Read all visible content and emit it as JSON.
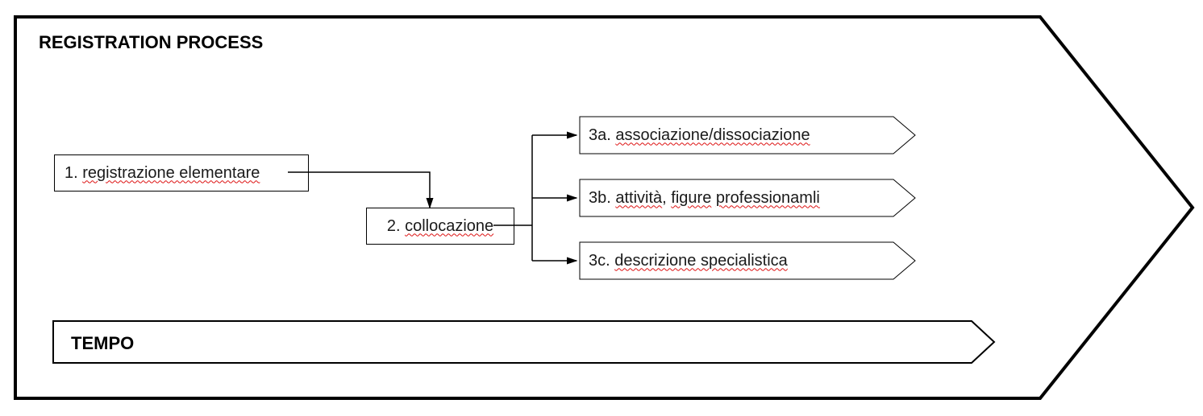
{
  "title": "REGISTRATION PROCESS",
  "step1": {
    "prefix": "1. ",
    "text": "registrazione elementare"
  },
  "step2": {
    "prefix": "2. ",
    "text": "collocazione"
  },
  "step3a": {
    "prefix": "3a. ",
    "text1": "associazione/dissociazione"
  },
  "step3b": {
    "prefix": "3b. ",
    "w1": "attività",
    "sep": ", ",
    "w2": "figure",
    "w3": " ",
    "w4": "professionamli"
  },
  "step3c": {
    "prefix": "3c. ",
    "text1": "descrizione specialistica"
  },
  "tempo": "TEMPO"
}
